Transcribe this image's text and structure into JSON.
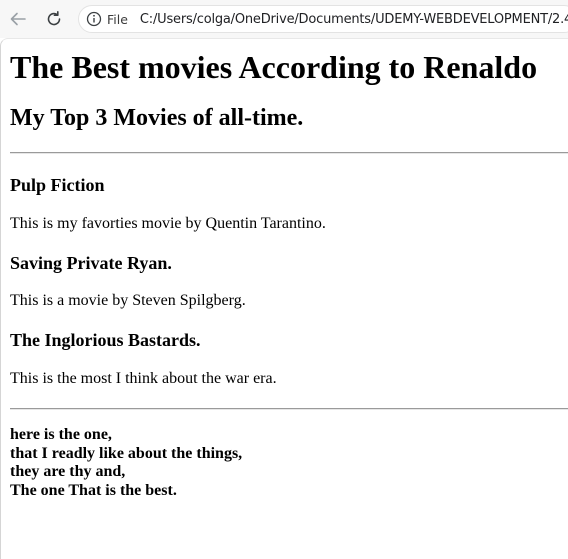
{
  "browser": {
    "scheme_label": "File",
    "url": "C:/Users/colga/OneDrive/Documents/UDEMY-WEBDEVELOPMENT/2.4"
  },
  "page": {
    "title": "The Best movies According to Renaldo",
    "subtitle": "My Top 3 Movies of all-time.",
    "movies": [
      {
        "title": "Pulp Fiction",
        "description": "This is my favorties movie by Quentin Tarantino."
      },
      {
        "title": "Saving Private Ryan.",
        "description": "This is a movie by Steven Spilgberg."
      },
      {
        "title": "The Inglorious Bastards.",
        "description": "This is the most I think about the war era."
      }
    ],
    "poem": [
      "here is the one,",
      "that I readly like about the things,",
      "they are thy and,",
      "The one That is the best."
    ]
  },
  "icons": {
    "back": "back-arrow-icon",
    "reload": "reload-icon",
    "info": "info-icon"
  }
}
